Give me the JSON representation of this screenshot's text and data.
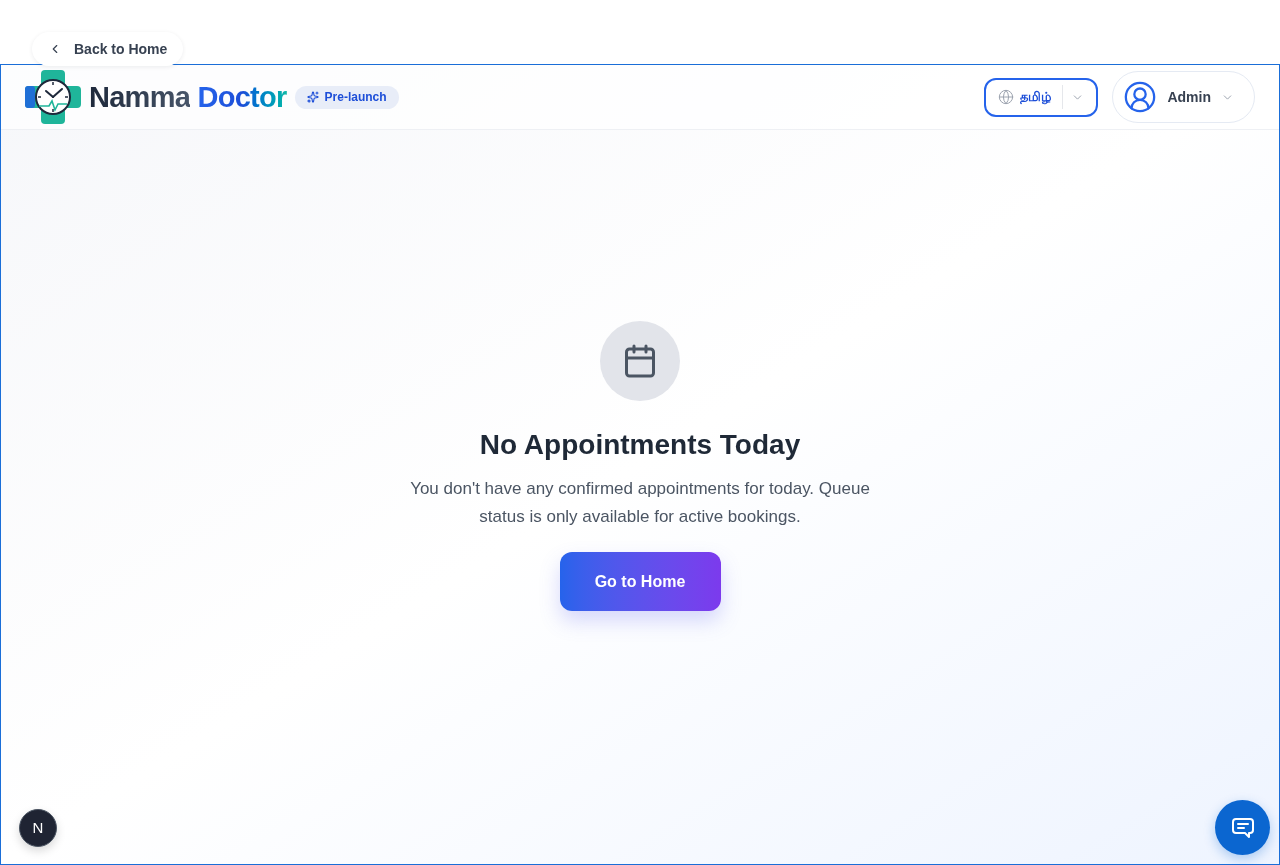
{
  "back_link": {
    "label": "Back to Home"
  },
  "header": {
    "brand": {
      "words": [
        "Namma",
        "Doctor"
      ]
    },
    "badge": {
      "label": "Pre-launch"
    },
    "language_select": {
      "value": "தமிழ்"
    },
    "user_menu": {
      "label": "Admin"
    }
  },
  "empty_state": {
    "title": "No Appointments Today",
    "message": "You don't have any confirmed appointments for today. Queue status is only available for active bookings.",
    "button": {
      "label": "Go to Home"
    }
  },
  "dev_indicator": {
    "label": "N"
  }
}
